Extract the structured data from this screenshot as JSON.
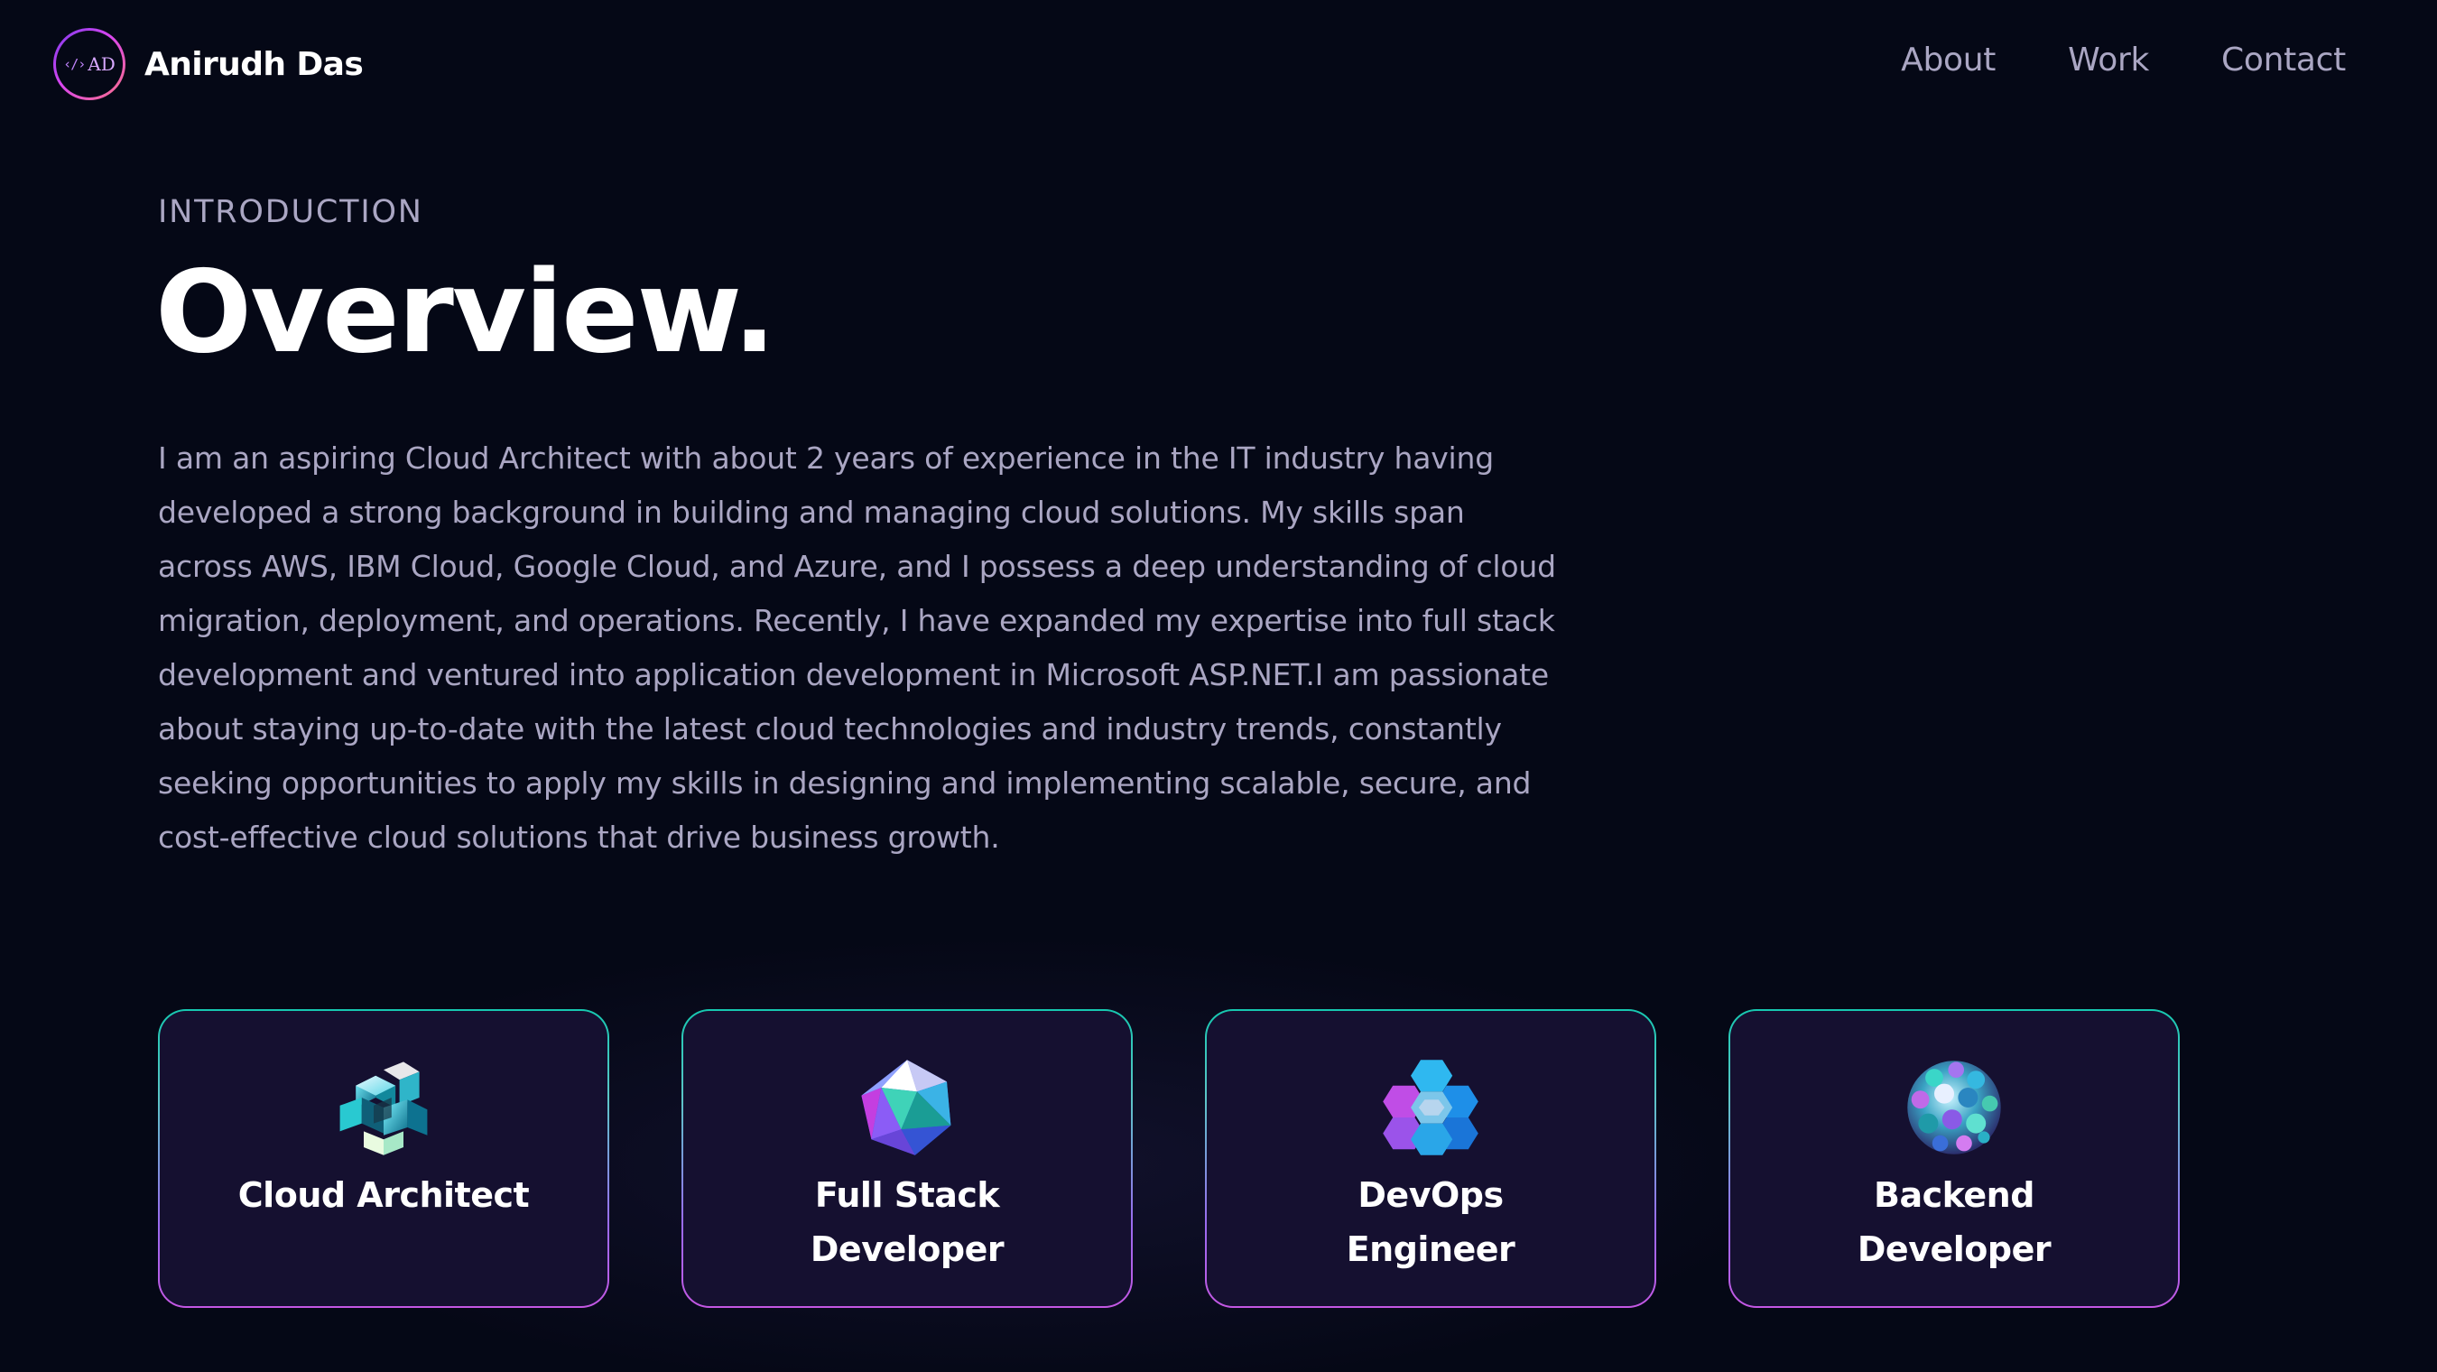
{
  "brand": {
    "logo_text": "AD",
    "logo_glyph": "‹/›",
    "name": "Anirudh Das"
  },
  "nav": {
    "links": [
      "About",
      "Work",
      "Contact"
    ]
  },
  "intro": {
    "subtitle": "INTRODUCTION",
    "title": "Overview.",
    "overview": "I am an aspiring Cloud Architect with about 2 years of experience in the IT industry having developed a strong background in building and managing cloud solutions. My skills span across AWS, IBM Cloud, Google Cloud, and Azure, and I possess a deep understanding of cloud migration, deployment, and operations. Recently, I have expanded my expertise into full stack development and ventured into application development in Microsoft ASP.NET.I am passionate about staying up-to-date with the latest cloud technologies and industry trends, constantly seeking opportunities to apply my skills in designing and implementing scalable, secure, and cost-effective cloud solutions that drive business growth."
  },
  "services": [
    {
      "title": "Cloud Architect",
      "icon": "cube-cluster-icon"
    },
    {
      "title": "Full Stack Developer",
      "icon": "icosahedron-icon"
    },
    {
      "title": "DevOps Engineer",
      "icon": "hex-cluster-icon"
    },
    {
      "title": "Backend Developer",
      "icon": "sphere-cluster-icon"
    }
  ],
  "colors": {
    "background": "#050816",
    "card_background": "#151030",
    "secondary_text": "#aaa6c3",
    "card_border_top": "#16c8b0",
    "card_border_bottom": "#c457e3"
  }
}
